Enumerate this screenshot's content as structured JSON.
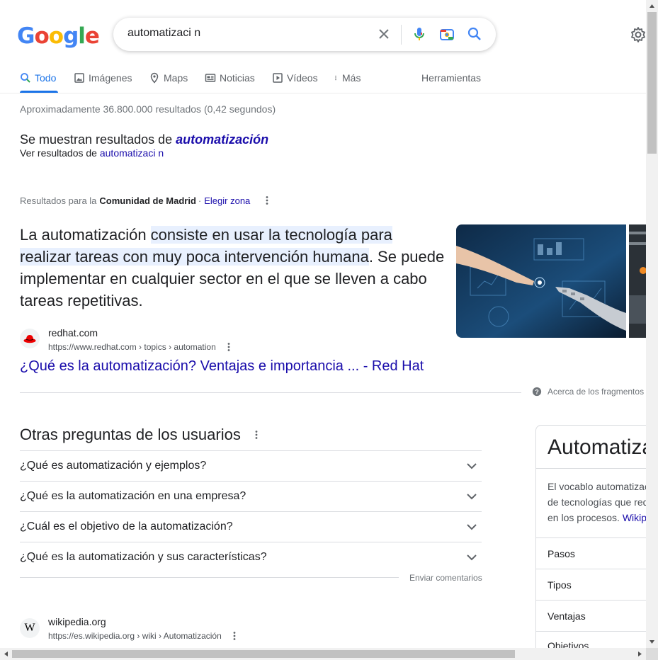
{
  "header": {
    "logo_letters": [
      "G",
      "o",
      "o",
      "g",
      "l",
      "e"
    ],
    "logo_colors": [
      "#4285f4",
      "#ea4335",
      "#fbbc05",
      "#4285f4",
      "#34a853",
      "#ea4335"
    ],
    "query": "automatizaci n",
    "icons": [
      "close-icon",
      "mic-icon",
      "camera-icon",
      "search-icon",
      "gear-icon"
    ]
  },
  "tabs": [
    {
      "label": "Todo",
      "icon": "search-icon",
      "active": true
    },
    {
      "label": "Imágenes",
      "icon": "image-icon"
    },
    {
      "label": "Maps",
      "icon": "map-pin-icon"
    },
    {
      "label": "Noticias",
      "icon": "news-icon"
    },
    {
      "label": "Vídeos",
      "icon": "play-icon"
    },
    {
      "label": "Más",
      "icon": "more-vert-icon"
    }
  ],
  "tools_label": "Herramientas",
  "result_stats": "Aproximadamente 36.800.000 resultados (0,42 segundos)",
  "spelling": {
    "shown_prefix": "Se muestran resultados de ",
    "corrected": "automatización",
    "original_prefix": "Ver resultados de ",
    "original": "automatizaci n"
  },
  "location": {
    "prefix": "Resultados para la",
    "region": "Comunidad de Madrid",
    "separator": "·",
    "change": "Elegir zona"
  },
  "snippet": {
    "text_start": "La automatización ",
    "text_highlight_1": "consiste en usar la tecnología para",
    "text_highlight_2": "realizar tareas con muy poca intervención humana",
    "text_end": ". Se puede implementar en cualquier sector en el que se lleven a cabo tareas repetitivas.",
    "source_name": "redhat.com",
    "source_url": "https://www.redhat.com › topics › automation",
    "link_title": "¿Qué es la automatización? Ventajas e importancia ... - Red Hat",
    "about": "Acerca de los fragmentos destacados"
  },
  "paa": {
    "title": "Otras preguntas de los usuarios",
    "questions": [
      "¿Qué es automatización y ejemplos?",
      "¿Qué es la automatización en una empresa?",
      "¿Cuál es el objetivo de la automatización?",
      "¿Qué es la automatización y sus características?"
    ],
    "feedback": "Enviar comentarios"
  },
  "result2": {
    "source_name": "wikipedia.org",
    "source_url": "https://es.wikipedia.org › wiki › Automatización"
  },
  "knowledge_panel": {
    "title": "Automatización",
    "desc_lines": [
      "El vocablo automatización",
      "de tecnologías que reducen",
      "en los procesos. "
    ],
    "desc_link": "Wikipedia",
    "items": [
      "Pasos",
      "Tipos",
      "Ventajas",
      "Objetivos"
    ]
  }
}
